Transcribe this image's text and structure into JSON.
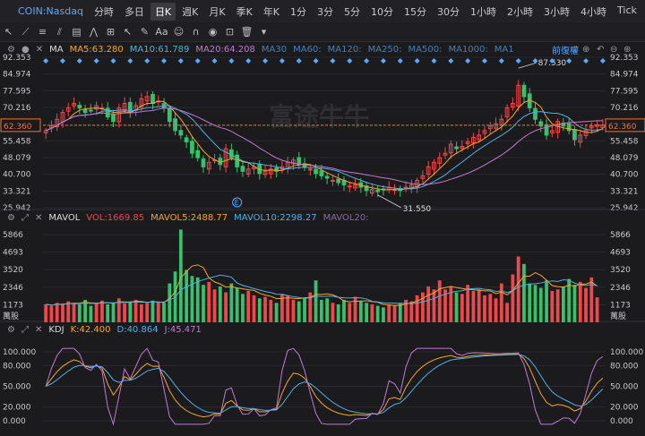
{
  "symbol": "COIN:Nasdaq",
  "period_tabs": [
    "分時",
    "多日",
    "日K",
    "週K",
    "月K",
    "季K",
    "年K",
    "1分",
    "3分",
    "5分",
    "10分",
    "15分",
    "30分",
    "1小時",
    "2小時",
    "3小時",
    "4小時",
    "Tick"
  ],
  "selected_period": "日K",
  "main_legend": {
    "name": "MA",
    "ma5": "MA5:63.280",
    "ma10": "MA10:61.789",
    "ma20": "MA20:64.208",
    "ma30": "MA30",
    "ma60": "MA60:",
    "ma120": "MA120:",
    "ma250": "MA250:",
    "ma500": "MA500:",
    "ma1000": "MA1000:",
    "ma_more": "MA1",
    "adjust": "前復權"
  },
  "price_axis": [
    "92.353",
    "84.974",
    "77.595",
    "70.216",
    "62.360",
    "55.458",
    "48.079",
    "40.700",
    "33.321",
    "25.942"
  ],
  "last_price_tag": "62.360",
  "high_marker": "87.530",
  "low_marker": "31.550",
  "event_marker": "E",
  "watermark": "富途牛牛",
  "vol_legend": {
    "name": "MAVOL",
    "vol": "VOL:1669.85",
    "ma5": "MAVOL5:2488.77",
    "ma10": "MAVOL10:2298.27",
    "ma20": "MAVOL20:"
  },
  "vol_axis": [
    "5866",
    "4693",
    "3520",
    "2346",
    "1173"
  ],
  "vol_unit": "萬股",
  "kdj_legend": {
    "name": "KDJ",
    "k": "K:42.400",
    "d": "D:40.864",
    "j": "J:45.471"
  },
  "kdj_axis": [
    "100.000",
    "80.000",
    "50.000",
    "20.000",
    "0.000"
  ],
  "colors": {
    "up": "#f0474a",
    "down": "#35c26b",
    "ma5": "#f5a623",
    "ma10": "#4fb0e5",
    "ma20": "#c178d6",
    "k": "#f5a623",
    "d": "#4fb0e5",
    "j": "#c178d6",
    "price_line": "#e8743a",
    "accent": "#5aa9ff"
  },
  "chart_data": {
    "type": "candlestick",
    "closes": [
      60,
      62,
      65,
      68,
      70,
      72,
      70,
      68,
      69,
      71,
      70,
      66,
      64,
      70,
      72,
      68,
      71,
      74,
      75,
      72,
      73,
      70,
      64,
      60,
      58,
      55,
      50,
      48,
      44,
      46,
      47,
      45,
      52,
      48,
      44,
      42,
      43,
      44,
      41,
      42,
      43,
      42,
      44,
      46,
      47,
      45,
      44,
      43,
      41,
      40,
      39,
      38,
      37,
      36,
      35.5,
      36,
      35,
      33.5,
      34,
      33,
      34,
      35,
      34,
      33.5,
      35,
      36,
      38,
      40,
      44,
      46,
      48,
      50,
      54,
      52,
      53,
      55,
      57,
      58,
      60,
      62,
      63,
      65,
      70,
      72,
      80,
      75,
      70,
      65,
      62,
      58,
      60,
      64,
      62,
      60,
      56,
      58,
      60,
      62,
      62.5,
      62.36
    ],
    "volumes": [
      1200,
      1100,
      1300,
      1250,
      1400,
      1300,
      1200,
      1500,
      1100,
      1300,
      1450,
      1200,
      1300,
      1600,
      1250,
      1400,
      1500,
      1200,
      1300,
      1450,
      1350,
      1300,
      2600,
      3400,
      6200,
      3500,
      3100,
      3000,
      2500,
      2700,
      2200,
      2400,
      2000,
      2600,
      2300,
      1900,
      2100,
      1800,
      1600,
      1700,
      1500,
      1300,
      1900,
      1800,
      1500,
      1400,
      1600,
      2000,
      2800,
      1500,
      1600,
      1300,
      1200,
      1500,
      1300,
      1700,
      1400,
      1300,
      1200,
      1100,
      1000,
      1200,
      1100,
      1300,
      1500,
      1400,
      1800,
      2000,
      2400,
      2200,
      2800,
      2200,
      2400,
      2000,
      1900,
      2500,
      2100,
      2200,
      1800,
      1900,
      1600,
      2600,
      1300,
      3200,
      4400,
      3900,
      2600,
      2500,
      2300,
      2800,
      2100,
      2200,
      2400,
      2900,
      2500,
      2700,
      2300,
      3000,
      1669.85
    ],
    "kdj": {
      "K": 42.4,
      "D": 40.864,
      "J": 45.471
    },
    "y_range_price": [
      25.942,
      92.353
    ],
    "y_range_volume": [
      0,
      5866
    ],
    "y_range_kdj": [
      0,
      100
    ]
  }
}
